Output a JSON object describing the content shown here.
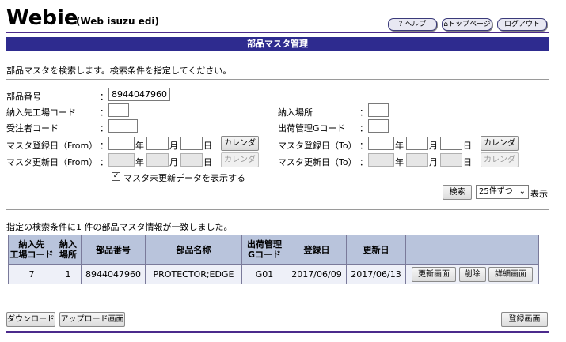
{
  "header": {
    "logo": "Webie",
    "logo_sub": "(Web isuzu edi)",
    "help": "? ヘルプ",
    "top_page": "トップページ",
    "logout": "ログアウト"
  },
  "title": "部品マスタ管理",
  "description": "部品マスタを検索します。検索条件を指定してください。",
  "form": {
    "part_number_label": "部品番号",
    "part_number_value": "8944047960",
    "delivery_plant_label": "納入先工場コード",
    "delivery_place_label": "納入場所",
    "receiver_label": "受注者コード",
    "shipping_g_label": "出荷管理Gコード",
    "reg_from_label": "マスタ登録日（From）",
    "reg_to_label": "マスタ登録日（To）",
    "upd_from_label": "マスタ更新日（From）",
    "upd_to_label": "マスタ更新日（To）",
    "colon": "：",
    "year": "年",
    "month": "月",
    "day": "日",
    "calendar": "カレンダ",
    "checkbox_label": "マスタ未更新データを表示する",
    "checkbox_mark": "✓",
    "search": "検索",
    "per_page": "25件ずつ",
    "per_page_suffix": "表示"
  },
  "result_message": "指定の検索条件に1 件の部品マスタ情報が一致しました。",
  "table": {
    "headers": [
      "納入先\n工場コード",
      "納入\n場所",
      "部品番号",
      "部品名称",
      "出荷管理\nGコード",
      "登録日",
      "更新日",
      ""
    ],
    "rows": [
      {
        "plant": "7",
        "place": "1",
        "part_no": "8944047960",
        "part_name": "PROTECTOR;EDGE",
        "g_code": "G01",
        "registered": "2017/06/09",
        "updated": "2017/06/13",
        "actions": [
          "更新画面",
          "削除",
          "詳細画面"
        ]
      }
    ]
  },
  "footer": {
    "download": "ダウンロード",
    "upload": "アップロード画面",
    "register": "登録画面"
  }
}
